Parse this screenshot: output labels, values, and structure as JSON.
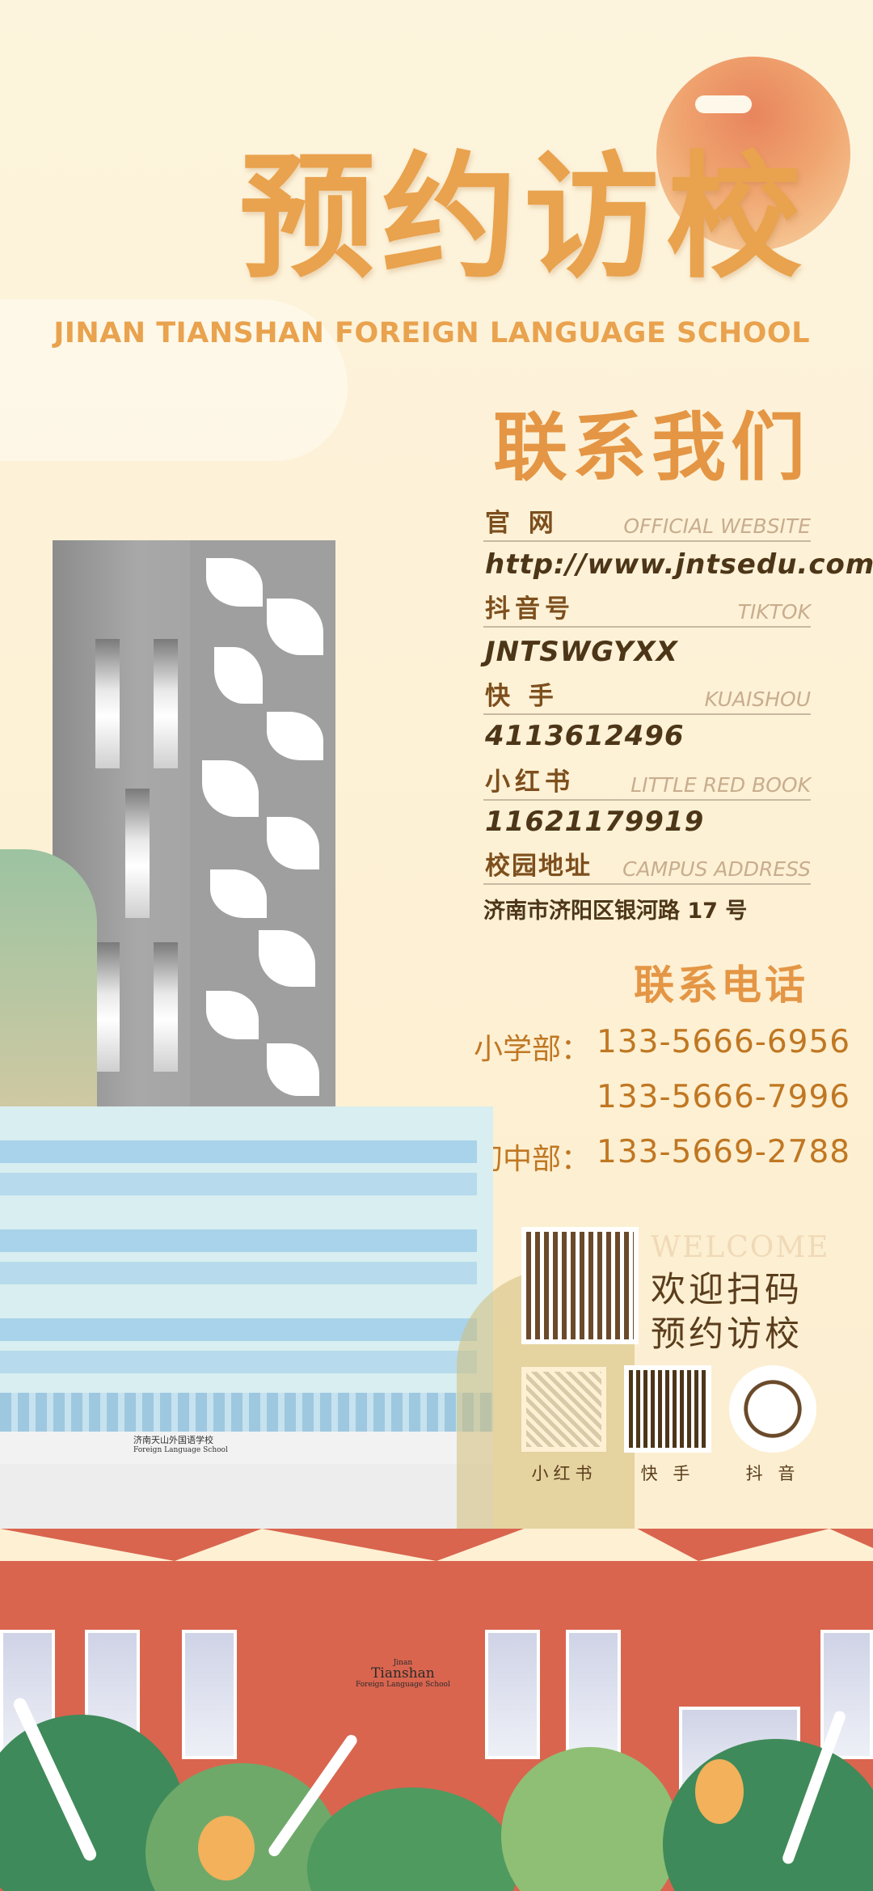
{
  "header": {
    "title": "预约访校",
    "subtitle": "JINAN TIANSHAN FOREIGN LANGUAGE SCHOOL"
  },
  "contact": {
    "title": "联系我们",
    "rows": [
      {
        "label_cn": "官 网",
        "label_en": "OFFICIAL WEBSITE",
        "value": "http://www.jntsedu.com"
      },
      {
        "label_cn": "抖音号",
        "label_en": "TIKTOK",
        "value": "JNTSWGYXX"
      },
      {
        "label_cn": "快 手",
        "label_en": "KUAISHOU",
        "value": "4113612496"
      },
      {
        "label_cn": "小红书",
        "label_en": "LITTLE RED BOOK",
        "value": "11621179919"
      },
      {
        "label_cn": "校园地址",
        "label_en": "CAMPUS ADDRESS",
        "value": "济南市济阳区银河路 17 号"
      }
    ]
  },
  "phones": {
    "title": "联系电话",
    "entries": [
      {
        "label": "小学部：",
        "number": "133-5666-6956"
      },
      {
        "label": "",
        "number": "133-5666-7996"
      },
      {
        "label": "初中部：",
        "number": "133-5669-2788"
      }
    ]
  },
  "scan": {
    "welcome": "WELCOME",
    "line1": "欢迎扫码",
    "line2": "预约访校",
    "qr_labels": [
      "小红书",
      "快 手",
      "抖 音"
    ]
  },
  "building_signs": {
    "top_cn": "济南天山外国语学校",
    "top_en": "Foreign Language School",
    "bottom_line1": "Jinan",
    "bottom_line2": "Tianshan",
    "bottom_line3": "Foreign Language School"
  },
  "colors": {
    "background": "#fdf4dd",
    "accent_orange": "#e9a24d",
    "phone_text": "#c07722",
    "brown_text": "#4d3618",
    "sun": "#e8855e",
    "wall_red": "#d9654f"
  }
}
